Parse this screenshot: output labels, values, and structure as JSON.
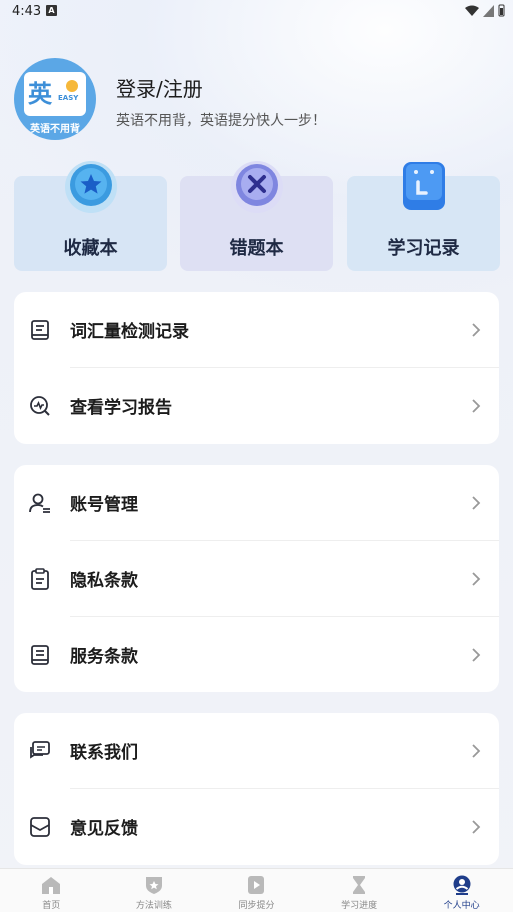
{
  "status_bar": {
    "time": "4:43",
    "notification_glyph": "A"
  },
  "profile": {
    "avatar_caption": "英语不用背",
    "avatar_char": "英",
    "avatar_tag": "EASY",
    "title": "登录/注册",
    "subtitle": "英语不用背，英语提分快人一步！"
  },
  "quick_actions": [
    {
      "label": "收藏本",
      "icon": "star-icon"
    },
    {
      "label": "错题本",
      "icon": "x-icon"
    },
    {
      "label": "学习记录",
      "icon": "clock-icon"
    }
  ],
  "menu_groups": [
    {
      "items": [
        {
          "label": "词汇量检测记录",
          "icon": "book-record-icon"
        },
        {
          "label": "查看学习报告",
          "icon": "report-search-icon"
        }
      ]
    },
    {
      "items": [
        {
          "label": "账号管理",
          "icon": "user-manage-icon"
        },
        {
          "label": "隐私条款",
          "icon": "clipboard-icon"
        },
        {
          "label": "服务条款",
          "icon": "document-icon"
        }
      ]
    },
    {
      "items": [
        {
          "label": "联系我们",
          "icon": "chat-icon"
        },
        {
          "label": "意见反馈",
          "icon": "mail-feedback-icon"
        }
      ]
    }
  ],
  "tabbar": [
    {
      "label": "首页",
      "icon": "home-icon",
      "active": false
    },
    {
      "label": "方法训练",
      "icon": "shield-icon",
      "active": false
    },
    {
      "label": "同步提分",
      "icon": "play-icon",
      "active": false
    },
    {
      "label": "学习进度",
      "icon": "hourglass-icon",
      "active": false
    },
    {
      "label": "个人中心",
      "icon": "profile-icon",
      "active": true
    }
  ],
  "colors": {
    "accent": "#1f3d8a",
    "brand_blue": "#3d8fd8",
    "muted": "#888888"
  }
}
